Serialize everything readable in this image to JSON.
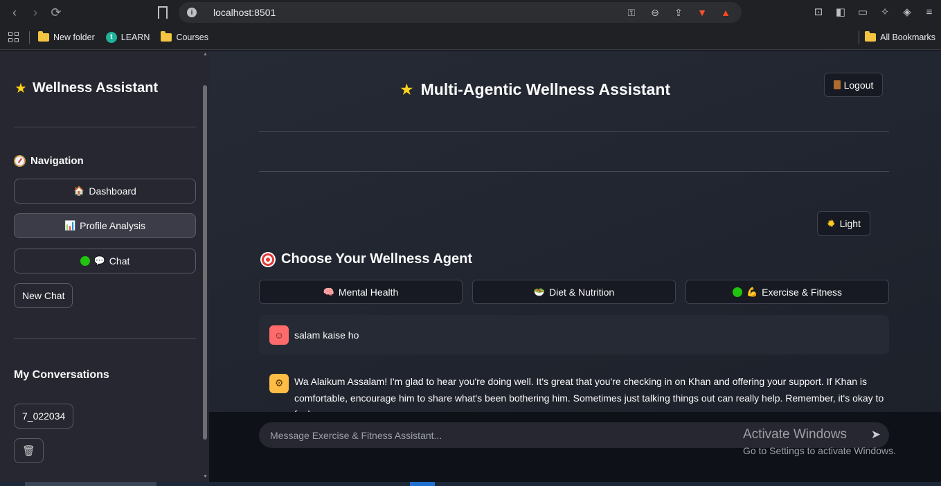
{
  "browser": {
    "url": "localhost:8501",
    "bookmarks": [
      "New folder",
      "LEARN",
      "Courses"
    ],
    "all_bookmarks": "All Bookmarks",
    "learn_icon_letter": "t"
  },
  "sidebar": {
    "title": "Wellness Assistant",
    "navigation_heading": "Navigation",
    "nav_items": [
      {
        "icon": "house-icon",
        "emoji": "🏠",
        "label": "Dashboard"
      },
      {
        "icon": "bar-chart-icon",
        "emoji": "📊",
        "label": "Profile Analysis"
      },
      {
        "icon": "speech-bubble-icon",
        "emoji": "💬",
        "label": "Chat"
      }
    ],
    "new_chat_label": "New Chat",
    "conversations_heading": "My Conversations",
    "conversation_id": "7_022034"
  },
  "main": {
    "title": "Multi-Agentic Wellness Assistant",
    "logout_label": "Logout",
    "theme_toggle_label": "Light",
    "choose_heading": "Choose Your Wellness Agent",
    "agents": [
      {
        "emoji": "🧠",
        "label": "Mental Health"
      },
      {
        "emoji": "🥗",
        "label": "Diet & Nutrition"
      },
      {
        "emoji": "💪",
        "label": "Exercise & Fitness"
      }
    ],
    "messages": {
      "user": "salam kaise ho",
      "assistant": "Wa Alaikum Assalam! I'm glad to hear you're doing well. It's great that you're checking in on Khan and offering your support. If Khan is comfortable, encourage him to share what's been bothering him. Sometimes just talking things out can really help. Remember, it's okay to feel"
    },
    "chat_placeholder": "Message Exercise & Fitness Assistant..."
  },
  "watermark": {
    "line1": "Activate Windows",
    "line2": "Go to Settings to activate Windows."
  },
  "colors": {
    "sidebar_bg": "#262730",
    "main_bg": "#1e222c",
    "active_dot": "#21c30f",
    "user_avatar": "#ff6b6b",
    "bot_avatar": "#ffbd45"
  }
}
